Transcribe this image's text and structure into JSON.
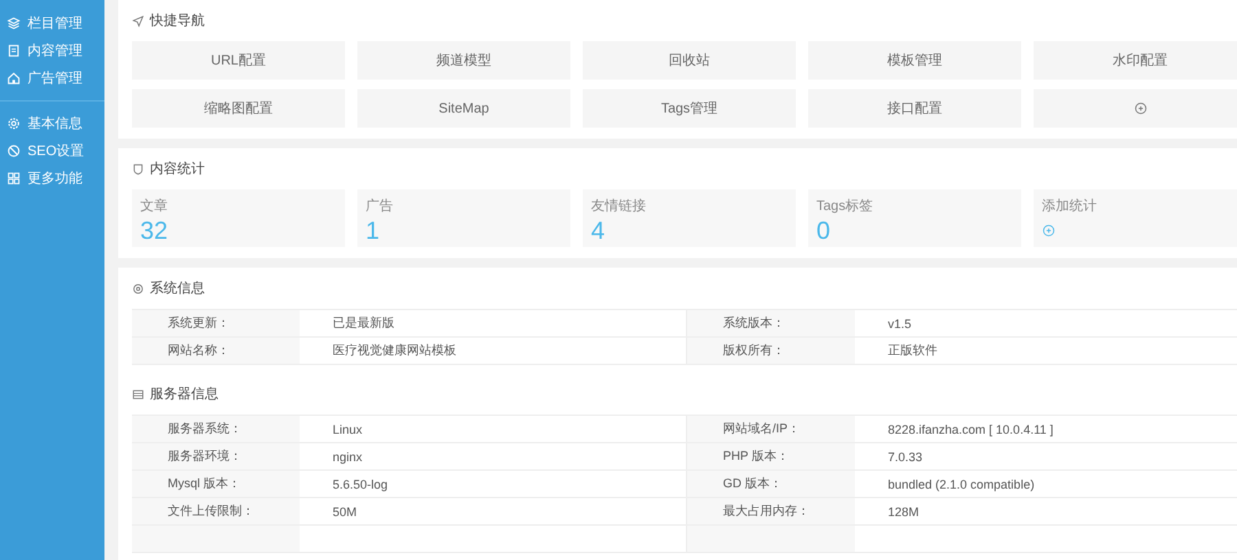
{
  "sidebar": {
    "groups": [
      [
        {
          "label": "栏目管理"
        },
        {
          "label": "内容管理"
        },
        {
          "label": "广告管理"
        }
      ],
      [
        {
          "label": "基本信息"
        },
        {
          "label": "SEO设置"
        },
        {
          "label": "更多功能"
        }
      ]
    ]
  },
  "quick_nav": {
    "title": "快捷导航",
    "items": [
      {
        "kind": "text",
        "label": "URL配置"
      },
      {
        "kind": "text",
        "label": "频道模型"
      },
      {
        "kind": "text",
        "label": "回收站"
      },
      {
        "kind": "text",
        "label": "模板管理"
      },
      {
        "kind": "text",
        "label": "水印配置"
      },
      {
        "kind": "text",
        "label": "缩略图配置"
      },
      {
        "kind": "text",
        "label": "SiteMap"
      },
      {
        "kind": "text",
        "label": "Tags管理"
      },
      {
        "kind": "text",
        "label": "接口配置"
      },
      {
        "kind": "add"
      }
    ]
  },
  "stats": {
    "title": "内容统计",
    "items": [
      {
        "kind": "count",
        "label": "文章",
        "value": "32"
      },
      {
        "kind": "count",
        "label": "广告",
        "value": "1"
      },
      {
        "kind": "count",
        "label": "友情链接",
        "value": "4"
      },
      {
        "kind": "count",
        "label": "Tags标签",
        "value": "0"
      },
      {
        "kind": "add",
        "label": "添加统计"
      }
    ]
  },
  "system_info": {
    "title": "系统信息",
    "rows": [
      [
        "系统更新：",
        "已是最新版",
        "系统版本：",
        "v1.5"
      ],
      [
        "网站名称：",
        "医疗视觉健康网站模板",
        "版权所有：",
        "正版软件"
      ]
    ]
  },
  "server_info": {
    "title": "服务器信息",
    "rows": [
      [
        "服务器系统：",
        "Linux",
        "网站域名/IP：",
        "8228.ifanzha.com [ 10.0.4.11 ]"
      ],
      [
        "服务器环境：",
        "nginx",
        "PHP 版本：",
        "7.0.33"
      ],
      [
        "Mysql 版本：",
        "5.6.50-log",
        "GD 版本：",
        "bundled (2.1.0 compatible)"
      ],
      [
        "文件上传限制：",
        "50M",
        "最大占用内存：",
        "128M"
      ]
    ]
  }
}
